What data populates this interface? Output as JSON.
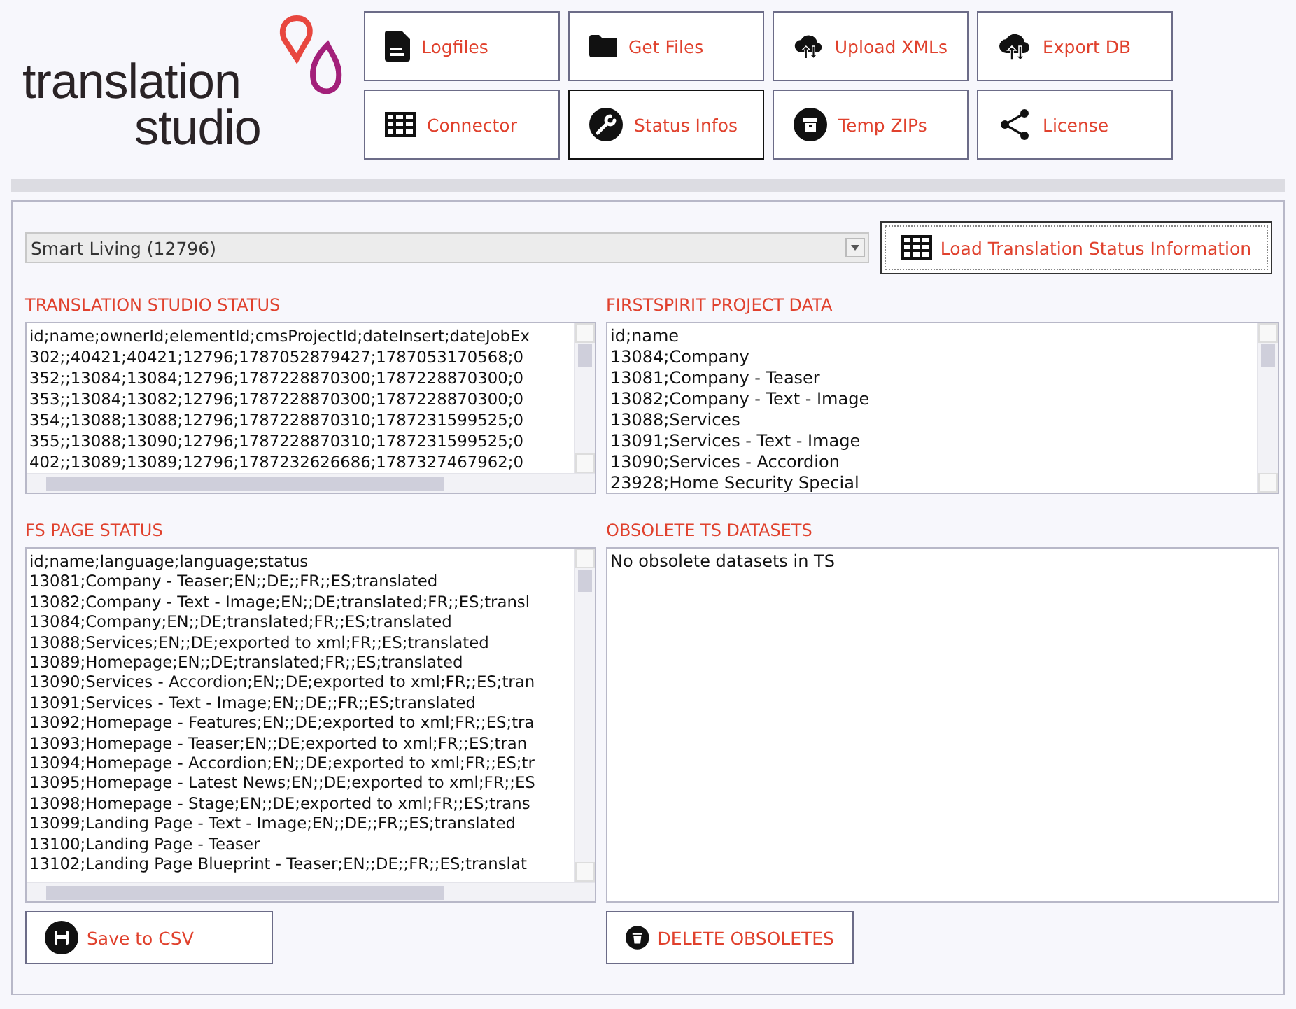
{
  "logo": {
    "line_1": "translation",
    "line_2": "studio"
  },
  "nav_buttons": [
    {
      "label": "Logfiles",
      "kind": "file",
      "selected": false
    },
    {
      "label": "Get Files",
      "kind": "folder",
      "selected": false
    },
    {
      "label": "Upload XMLs",
      "kind": "cloud",
      "selected": false
    },
    {
      "label": "Export DB",
      "kind": "cloud",
      "selected": false
    },
    {
      "label": "Connector",
      "kind": "table",
      "selected": false
    },
    {
      "label": "Status Infos",
      "kind": "wrench",
      "selected": true
    },
    {
      "label": "Temp ZIPs",
      "kind": "archive",
      "selected": false
    },
    {
      "label": "License",
      "kind": "share",
      "selected": false
    }
  ],
  "project_select": {
    "value": "Smart Living (12796)"
  },
  "load_button": {
    "label": "Load Translation Status Information"
  },
  "panels": [
    {
      "title": "TRANSLATION STUDIO STATUS",
      "lines": [
        "id;name;ownerId;elementId;cmsProjectId;dateInsert;dateJobEx",
        "302;;40421;40421;12796;1787052879427;1787053170568;0",
        "352;;13084;13084;12796;1787228870300;1787228870300;0",
        "353;;13084;13082;12796;1787228870300;1787228870300;0",
        "354;;13088;13088;12796;1787228870310;1787231599525;0",
        "355;;13088;13090;12796;1787228870310;1787231599525;0",
        "402;;13089;13089;12796;1787232626686;1787327467962;0"
      ]
    },
    {
      "title": "FIRSTSPIRIT PROJECT DATA",
      "lines": [
        "id;name",
        "13084;Company",
        "13081;Company - Teaser",
        "13082;Company - Text - Image",
        "13088;Services",
        "13091;Services - Text - Image",
        "13090;Services - Accordion",
        "23928;Home Security Special"
      ]
    },
    {
      "title": "FS PAGE STATUS",
      "lines": [
        "id;name;language;language;status",
        "13081;Company - Teaser;EN;;DE;;FR;;ES;translated",
        "13082;Company - Text - Image;EN;;DE;translated;FR;;ES;transl",
        "13084;Company;EN;;DE;translated;FR;;ES;translated",
        "13088;Services;EN;;DE;exported to xml;FR;;ES;translated",
        "13089;Homepage;EN;;DE;translated;FR;;ES;translated",
        "13090;Services - Accordion;EN;;DE;exported to xml;FR;;ES;tran",
        "13091;Services - Text - Image;EN;;DE;;FR;;ES;translated",
        "13092;Homepage - Features;EN;;DE;exported to xml;FR;;ES;tra",
        "13093;Homepage - Teaser;EN;;DE;exported to xml;FR;;ES;tran",
        "13094;Homepage - Accordion;EN;;DE;exported to xml;FR;;ES;tr",
        "13095;Homepage - Latest News;EN;;DE;exported to xml;FR;;ES",
        "13098;Homepage - Stage;EN;;DE;exported to xml;FR;;ES;trans",
        "13099;Landing Page - Text - Image;EN;;DE;;FR;;ES;translated",
        "13100;Landing Page - Teaser",
        "13102;Landing Page Blueprint - Teaser;EN;;DE;;FR;;ES;translat"
      ],
      "button": {
        "label": "Save to CSV",
        "kind": "save"
      }
    },
    {
      "title": "OBSOLETE TS DATASETS",
      "lines": [
        "No obsolete datasets in TS"
      ],
      "button": {
        "label": "DELETE OBSOLETES",
        "kind": "trash"
      }
    }
  ]
}
